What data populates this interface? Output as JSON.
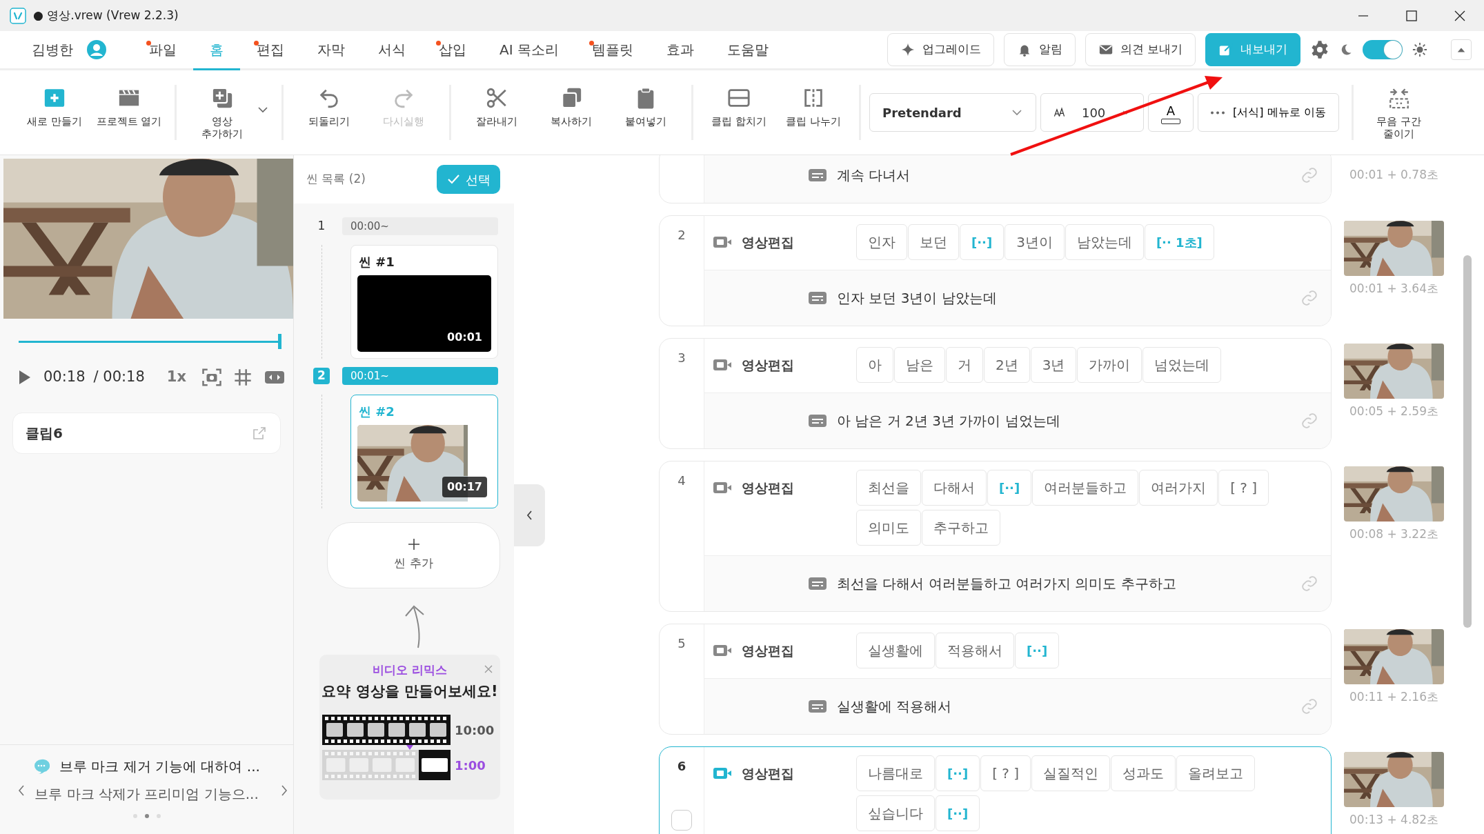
{
  "window": {
    "title": "● 영상.vrew (Vrew 2.2.3)"
  },
  "menu": {
    "user": "김병한",
    "tabs": [
      {
        "label": "파일",
        "selected": false,
        "dot": true
      },
      {
        "label": "홈",
        "selected": true,
        "dot": false
      },
      {
        "label": "편집",
        "selected": false,
        "dot": true
      },
      {
        "label": "자막",
        "selected": false,
        "dot": false
      },
      {
        "label": "서식",
        "selected": false,
        "dot": false
      },
      {
        "label": "삽입",
        "selected": false,
        "dot": true
      },
      {
        "label": "AI 목소리",
        "selected": false,
        "dot": false
      },
      {
        "label": "템플릿",
        "selected": false,
        "dot": true
      },
      {
        "label": "효과",
        "selected": false,
        "dot": false
      },
      {
        "label": "도움말",
        "selected": false,
        "dot": false
      }
    ]
  },
  "actions": [
    {
      "label": "업그레이드",
      "kind": "outline"
    },
    {
      "label": "알림",
      "kind": "outline"
    },
    {
      "label": "의견 보내기",
      "kind": "outline"
    },
    {
      "label": "내보내기",
      "kind": "primary"
    }
  ],
  "theme_toggle": {
    "on": true
  },
  "toolbar": {
    "groups": [
      [
        {
          "label": "새로 만들기",
          "disabled": false
        },
        {
          "label": "프로젝트 열기",
          "disabled": false
        }
      ],
      [
        {
          "label": "영상\n추가하기",
          "disabled": false,
          "dropdown": true
        }
      ],
      [
        {
          "label": "되돌리기",
          "disabled": false
        },
        {
          "label": "다시실행",
          "disabled": true
        }
      ],
      [
        {
          "label": "잘라내기",
          "disabled": false
        },
        {
          "label": "복사하기",
          "disabled": false
        },
        {
          "label": "붙여넣기",
          "disabled": false
        }
      ],
      [
        {
          "label": "클립 합치기",
          "disabled": false
        },
        {
          "label": "클립 나누기",
          "disabled": false
        }
      ]
    ],
    "font": "Pretendard",
    "size": "100",
    "color_button": "A",
    "format_link": "[서식] 메뉴로 이동",
    "trim": {
      "label": "무음 구간\n줄이기",
      "disabled": false
    }
  },
  "player": {
    "current": "00:18",
    "total": "/ 00:18",
    "speed": "1x",
    "level": 1
  },
  "clip_card": {
    "title": "클립6"
  },
  "notice": {
    "title": "브루 마크 제거 기능에 대하여 ...",
    "text": "브루 마크 삭제가 프리미엄 기능으...",
    "pages": [
      {
        "selected": false
      },
      {
        "selected": true
      },
      {
        "selected": false
      }
    ]
  },
  "scenes": {
    "title": "씬 목록 (2)",
    "select_button": "선택",
    "items": [
      {
        "number": "1",
        "start": "00:00~",
        "name": "씬 #1",
        "duration": "00:01",
        "selected": false,
        "kind": "blank"
      },
      {
        "number": "2",
        "start": "00:01~",
        "name": "씬 #2",
        "duration": "00:17",
        "selected": true,
        "kind": "picture"
      }
    ],
    "add_label": "씬 추가"
  },
  "promo": {
    "label": "비디오 리믹스",
    "title": "요약 영상을 만들어보세요!",
    "from": "10:00",
    "to": "1:00"
  },
  "clips": [
    {
      "kind": "partial",
      "subtitle": "계속 다녀서",
      "time": "00:01 + 0.78초",
      "selected": false
    },
    {
      "kind": "full",
      "number": "2",
      "label": "영상편집",
      "words": [
        {
          "text": "인자",
          "kind": "word"
        },
        {
          "text": "보던",
          "kind": "word"
        },
        {
          "text": "[··]",
          "kind": "pause"
        },
        {
          "text": "3년이",
          "kind": "word"
        },
        {
          "text": "남았는데",
          "kind": "word"
        },
        {
          "text": "[·· 1초]",
          "kind": "pause"
        }
      ],
      "subtitle": "인자 보던 3년이 남았는데",
      "time": "00:01 + 3.64초",
      "selected": false
    },
    {
      "kind": "full",
      "number": "3",
      "label": "영상편집",
      "words": [
        {
          "text": "아",
          "kind": "word"
        },
        {
          "text": "남은",
          "kind": "word"
        },
        {
          "text": "거",
          "kind": "word"
        },
        {
          "text": "2년",
          "kind": "word"
        },
        {
          "text": "3년",
          "kind": "word"
        },
        {
          "text": "가까이",
          "kind": "word"
        },
        {
          "text": "넘었는데",
          "kind": "word"
        }
      ],
      "subtitle": "아 남은 거 2년 3년 가까이 넘었는데",
      "time": "00:05 + 2.59초",
      "selected": false
    },
    {
      "kind": "full",
      "number": "4",
      "label": "영상편집",
      "words": [
        {
          "text": "최선을",
          "kind": "word"
        },
        {
          "text": "다해서",
          "kind": "word"
        },
        {
          "text": "[··]",
          "kind": "pause"
        },
        {
          "text": "여러분들하고",
          "kind": "word"
        },
        {
          "text": "여러가지",
          "kind": "word"
        },
        {
          "text": "[ ? ]",
          "kind": "unknown"
        },
        {
          "text": "의미도",
          "kind": "word"
        },
        {
          "text": "추구하고",
          "kind": "word"
        }
      ],
      "subtitle": "최선을 다해서 여러분들하고 여러가지 의미도 추구하고",
      "time": "00:08 + 3.22초",
      "selected": false
    },
    {
      "kind": "full",
      "number": "5",
      "label": "영상편집",
      "words": [
        {
          "text": "실생활에",
          "kind": "word"
        },
        {
          "text": "적용해서",
          "kind": "word"
        },
        {
          "text": "[··]",
          "kind": "pause"
        }
      ],
      "subtitle": "실생활에 적용해서",
      "time": "00:11 + 2.16초",
      "selected": false
    },
    {
      "kind": "full",
      "number": "6",
      "label": "영상편집",
      "words": [
        {
          "text": "나름대로",
          "kind": "word"
        },
        {
          "text": "[··]",
          "kind": "pause"
        },
        {
          "text": "[ ? ]",
          "kind": "unknown"
        },
        {
          "text": "실질적인",
          "kind": "word"
        },
        {
          "text": "성과도",
          "kind": "word"
        },
        {
          "text": "올려보고",
          "kind": "word"
        },
        {
          "text": "싶습니다",
          "kind": "word"
        },
        {
          "text": "[··]",
          "kind": "pause"
        }
      ],
      "time": "00:13 + 4.82초",
      "selected": true,
      "checked": false
    }
  ]
}
